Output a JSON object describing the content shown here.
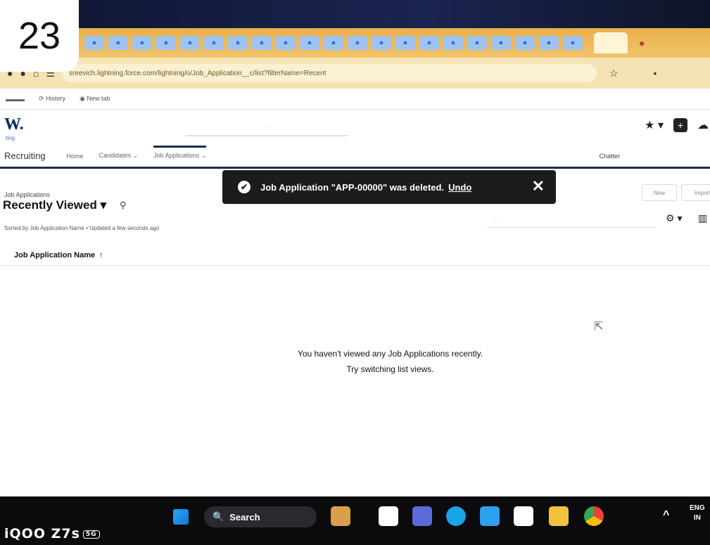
{
  "badge": "23",
  "browser": {
    "url": "sreevich.lightning.force.com/lightning/o/Job_Application__c/list?filterName=Recent",
    "bookmarks": [
      "History",
      "New tab"
    ]
  },
  "app": {
    "logo": "W.",
    "logo_sub": "ting",
    "name": "Recruiting",
    "nav": [
      "Home",
      "Candidates",
      "Job Applications",
      "Chatter"
    ]
  },
  "list": {
    "object_label": "Job Applications",
    "title": "Recently Viewed",
    "meta": "Sorted by Job Application Name • Updated a few seconds ago",
    "new_button": "New",
    "import_button": "Import",
    "column": "Job Application Name",
    "empty_line1": "You haven't viewed any Job Applications recently.",
    "empty_line2": "Try switching list views."
  },
  "toast": {
    "message": "Job Application \"APP-00000\" was deleted.",
    "undo": "Undo"
  },
  "taskbar": {
    "search": "Search",
    "lang_top": "ENG",
    "lang_bottom": "IN"
  },
  "watermark": {
    "text": "iQOO Z7s",
    "tag": "5G"
  }
}
